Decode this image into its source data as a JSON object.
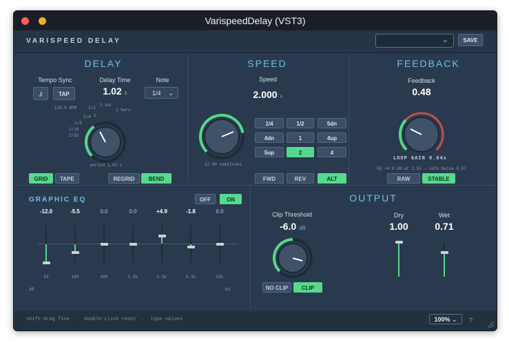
{
  "window": {
    "title": "VarispeedDelay (VST3)"
  },
  "header": {
    "brand": "VARISPEED DELAY",
    "preset_value": "",
    "save_label": "SAVE"
  },
  "delay": {
    "title": "DELAY",
    "tempo_sync_label": "Tempo Sync",
    "tap_label": "TAP",
    "bpm_text": "120.0 BPM",
    "delay_time_label": "Delay Time",
    "delay_time_value": "1.02",
    "delay_time_unit": "s",
    "note_label": "Note",
    "note_value": "1/4",
    "note_ticks": [
      "1/2",
      "1",
      "1 bar",
      "2 bars",
      "1/4",
      "1/8",
      "1/16",
      "1/32"
    ],
    "period_text": "period 1.02 s",
    "buttons": {
      "grid": "GRID",
      "tape": "TAPE",
      "regrid": "REGRID",
      "bend": "BEND"
    }
  },
  "speed": {
    "title": "SPEED",
    "speed_label": "Speed",
    "speed_value": "2.000",
    "speed_unit": "x",
    "semitones_text": "12.00 semitones",
    "grid_buttons": [
      "1/4",
      "1/2",
      "5dn",
      "4dn",
      "1",
      "4up",
      "5up",
      "2",
      "4"
    ],
    "selected": "2",
    "direction_buttons": [
      "FWD",
      "REV",
      "ALT"
    ],
    "direction_selected": "ALT"
  },
  "feedback": {
    "title": "FEEDBACK",
    "feedback_label": "Feedback",
    "feedback_value": "0.48",
    "loop_gain_text": "LOOP GAIN 0.84x",
    "eq_note": "EQ +4.9 dB at 2.5k - safe below 0.57",
    "mode_buttons": [
      "RAW",
      "STABLE"
    ],
    "mode_selected": "STABLE"
  },
  "eq": {
    "title": "GRAPHIC EQ",
    "toggle": [
      "OFF",
      "ON"
    ],
    "toggle_selected": "ON",
    "bands": [
      {
        "value": "-12.0",
        "freq": "63",
        "db": -12.0
      },
      {
        "value": "-5.5",
        "freq": "160",
        "db": -5.5
      },
      {
        "value": "0.0",
        "freq": "400",
        "db": 0.0
      },
      {
        "value": "0.0",
        "freq": "1.0k",
        "db": 0.0
      },
      {
        "value": "+4.9",
        "freq": "2.5k",
        "db": 4.9
      },
      {
        "value": "-1.8",
        "freq": "6.3k",
        "db": -1.8
      },
      {
        "value": "0.0",
        "freq": "16k",
        "db": 0.0
      }
    ],
    "db_label": "dB",
    "hz_label": "Hz"
  },
  "output": {
    "title": "OUTPUT",
    "clip_threshold_label": "Clip Threshold",
    "clip_threshold_value": "-6.0",
    "clip_threshold_unit": "dB",
    "clip_buttons": [
      "NO CLIP",
      "CLIP"
    ],
    "clip_selected": "CLIP",
    "dry_label": "Dry",
    "dry_value": "1.00",
    "dry_level": 1.0,
    "wet_label": "Wet",
    "wet_value": "0.71",
    "wet_level": 0.71
  },
  "footer": {
    "hints": "shift-drag fine  .  double-click reset  .  type values",
    "zoom_value": "100%",
    "help_label": "?"
  },
  "colors": {
    "accent_green": "#56d98c",
    "accent_blue": "#6fc0e6",
    "panel_bg": "#2a3a4e",
    "feedback_red": "#c0504f"
  }
}
